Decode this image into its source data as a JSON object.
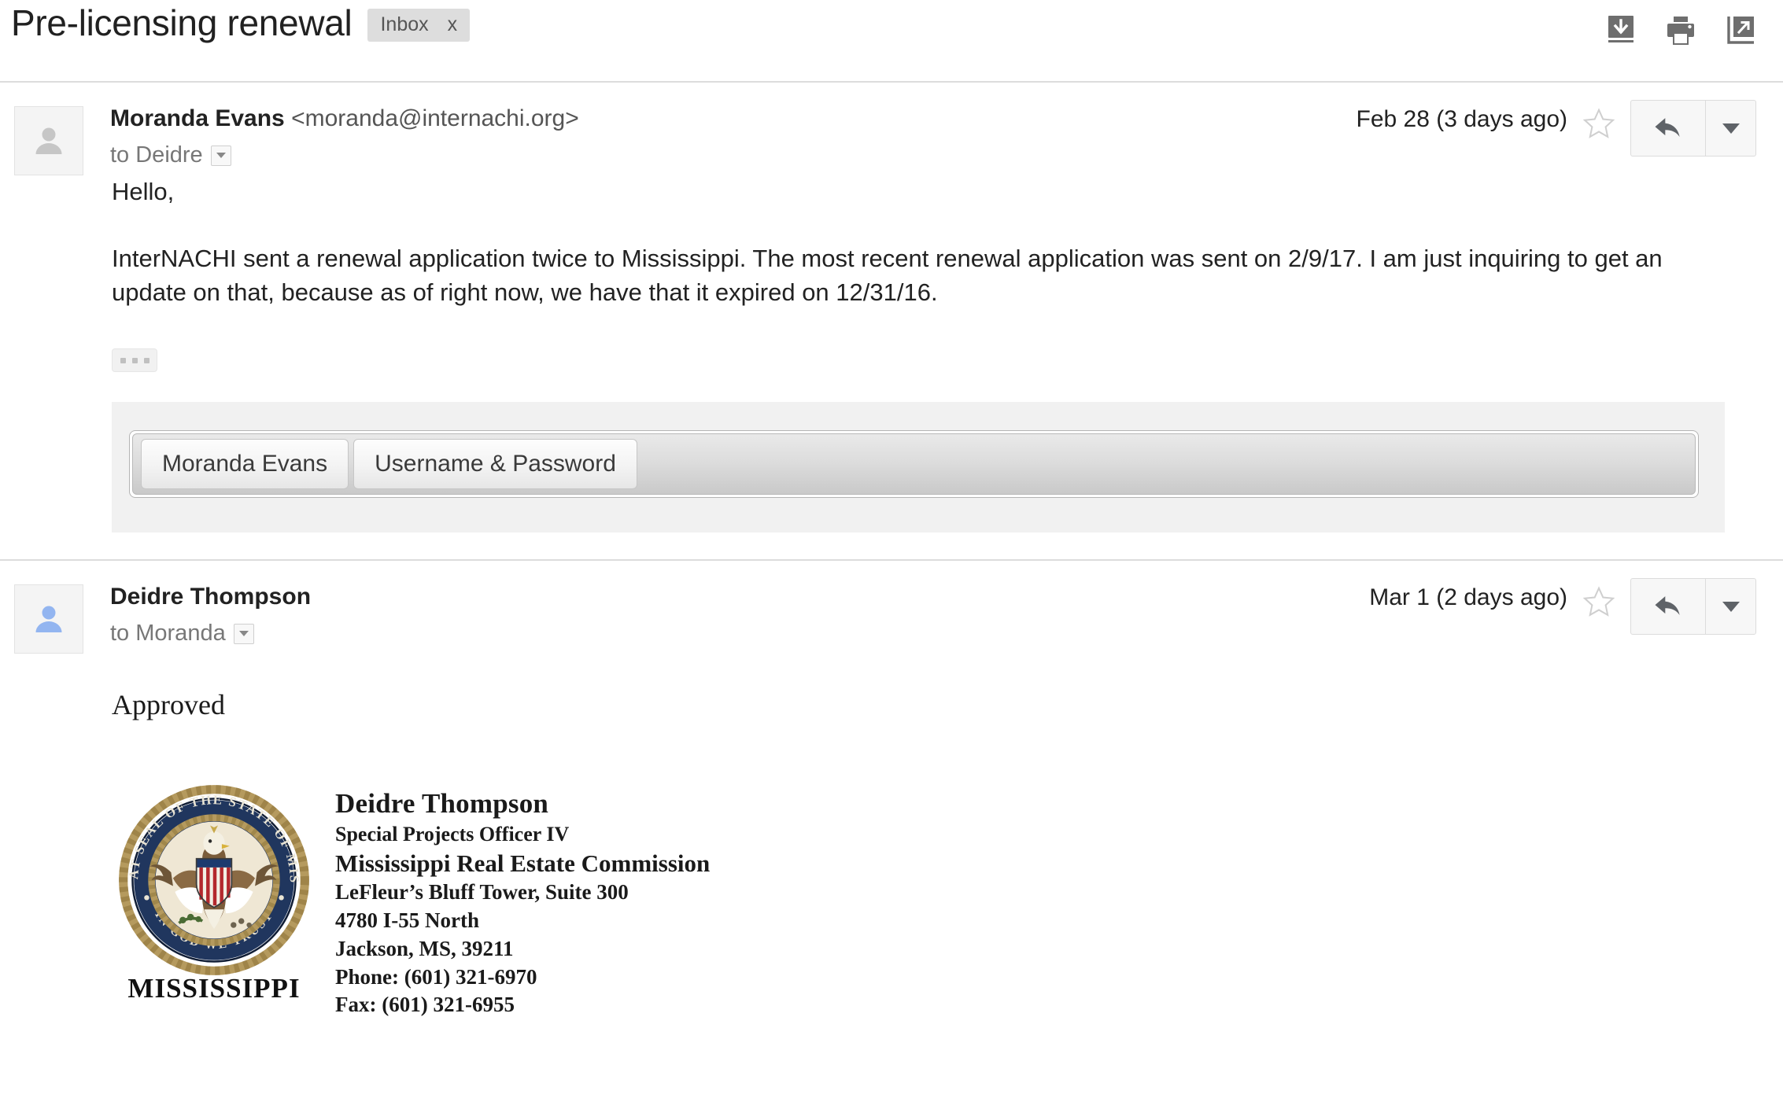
{
  "subject": {
    "title": "Pre-licensing renewal",
    "label": "Inbox",
    "label_remove": "x"
  },
  "toolbar_icons": [
    {
      "name": "download-icon",
      "title": "Download"
    },
    {
      "name": "print-icon",
      "title": "Print all"
    },
    {
      "name": "open-in-new-window-icon",
      "title": "In new window"
    }
  ],
  "messages": [
    {
      "sender_name": "Moranda Evans",
      "sender_email": "<moranda@internachi.org>",
      "recipient": "to Deidre",
      "date": "Feb 28 (3 days ago)",
      "avatar_color": "#c6c6c6",
      "body_paragraphs": [
        "Hello,",
        "InterNACHI sent a renewal application twice to Mississippi. The most recent renewal application was sent on 2/9/17. I am just inquiring to get an update on that, because as of right now, we have that it expired on 12/31/16."
      ],
      "trimmed_content_button": "...",
      "embedded_toolbar": {
        "buttons": [
          "Moranda Evans",
          "Username & Password"
        ]
      }
    },
    {
      "sender_name": "Deidre Thompson",
      "sender_email": "",
      "recipient": "to Moranda",
      "date": "Mar 1 (2 days ago)",
      "avatar_color": "#93b5f0",
      "body_paragraphs": [
        "Approved"
      ],
      "signature": {
        "seal_ring_top": "THE GREAT SEAL OF THE STATE OF MISSISSIPPI",
        "seal_ring_bottom": "IN GOD WE TRUST",
        "seal_caption": "MISSISSIPPI",
        "name": "Deidre Thompson",
        "role": "Special Projects Officer IV",
        "organization": "Mississippi Real Estate Commission",
        "address_1": "LeFleur’s Bluff Tower, Suite 300",
        "address_2": "4780 I-55 North",
        "address_3": "Jackson, MS, 39211",
        "phone": "Phone: (601) 321-6970",
        "fax": "Fax: (601) 321-6955"
      }
    }
  ],
  "colors": {
    "divider": "#e0e0e0",
    "label_chip_bg": "#dddddd",
    "panel_bg": "#f1f1f1",
    "seal_navy": "#20365e",
    "seal_gold": "#b59a5e"
  }
}
